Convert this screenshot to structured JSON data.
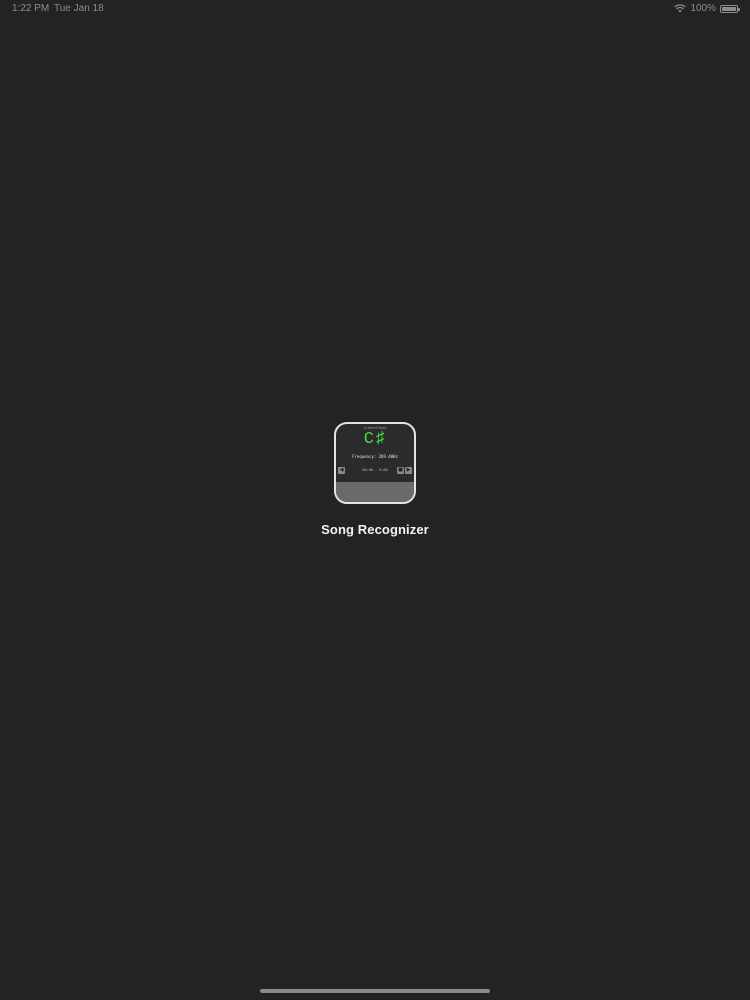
{
  "status_bar": {
    "time": "1:22 PM",
    "date": "Tue Jan 18",
    "battery_percent": "100%",
    "wifi_icon": "wifi-icon",
    "battery_icon": "battery-icon",
    "text_color": "#8d8d8f"
  },
  "app_icon": {
    "header_label": "Current Note",
    "note": "C♯",
    "frequency": "Frequency: 269.40Hz",
    "time": "00:00 - 0:00",
    "prev_glyph": "◀",
    "stop_glyph": "■",
    "next_glyph": "▶",
    "note_color": "#3fdc42",
    "border_color": "#e4e4e6"
  },
  "app_name": "Song Recognizer",
  "background_color": "#232224"
}
